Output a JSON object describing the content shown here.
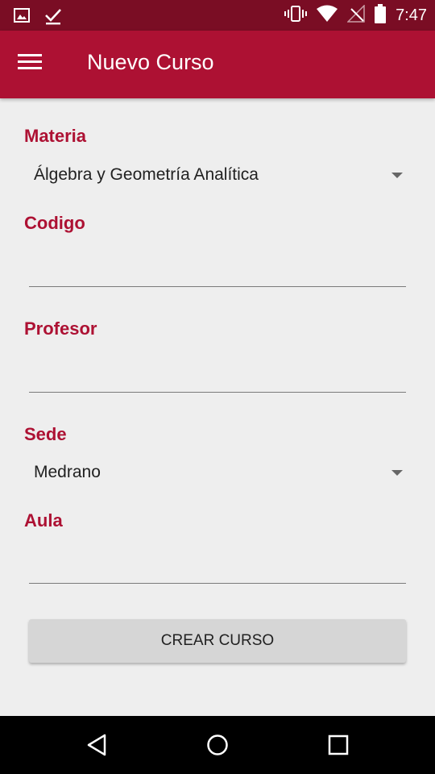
{
  "status_bar": {
    "time": "7:47",
    "icons": [
      "image-icon",
      "checkmark-icon",
      "vibrate-icon",
      "wifi-icon",
      "no-signal-icon",
      "battery-icon"
    ]
  },
  "app_bar": {
    "title": "Nuevo Curso",
    "menu_icon": "hamburger-menu-icon"
  },
  "form": {
    "materia": {
      "label": "Materia",
      "selected": "Álgebra y Geometría Analítica"
    },
    "codigo": {
      "label": "Codigo",
      "value": ""
    },
    "profesor": {
      "label": "Profesor",
      "value": ""
    },
    "sede": {
      "label": "Sede",
      "selected": "Medrano"
    },
    "aula": {
      "label": "Aula",
      "value": ""
    },
    "submit_label": "CREAR CURSO"
  },
  "nav_bar": {
    "icons": [
      "back-icon",
      "home-icon",
      "recents-icon"
    ]
  },
  "colors": {
    "status_bar": "#7a0d24",
    "primary": "#ad1133",
    "background": "#eeeeee",
    "button": "#d6d6d6"
  }
}
